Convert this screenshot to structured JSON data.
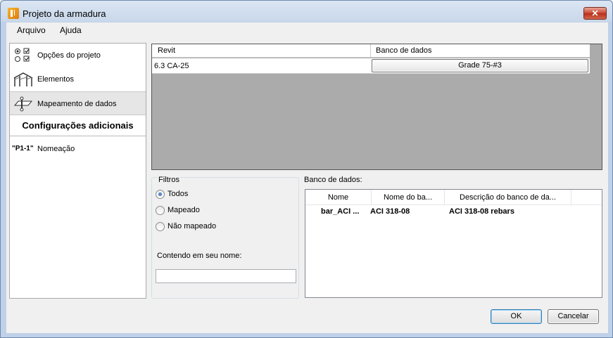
{
  "window": {
    "title": "Projeto da armadura"
  },
  "menu": [
    "Arquivo",
    "Ajuda"
  ],
  "sidebar": {
    "items": [
      {
        "label": "Opções do projeto",
        "icon": "options-icon"
      },
      {
        "label": "Elementos",
        "icon": "elements-icon"
      },
      {
        "label": "Mapeamento de dados",
        "icon": "data-mapping-icon"
      }
    ],
    "header": "Configurações adicionais",
    "naming": {
      "badge": "\"P1-1\"",
      "label": "Nomeação"
    }
  },
  "grid": {
    "columns": [
      "Revit",
      "Banco de dados"
    ],
    "rows": [
      {
        "revit": "6.3 CA-25",
        "database": "Grade 75-#3"
      }
    ]
  },
  "filters": {
    "legend": "Filtros",
    "options": [
      "Todos",
      "Mapeado",
      "Não mapeado"
    ],
    "selected": "Todos",
    "name_label": "Contendo em seu nome:",
    "name_value": ""
  },
  "database": {
    "label": "Banco de dados:",
    "columns": [
      "Nome",
      "Nome do ba...",
      "Descrição do banco de da..."
    ],
    "rows": [
      {
        "name": "bar_ACI ...",
        "db_name": "ACI 318-08",
        "description": "ACI 318-08 rebars"
      }
    ]
  },
  "buttons": {
    "ok": "OK",
    "cancel": "Cancelar"
  },
  "colors": {
    "accent": "#1d57a5",
    "grid_bg": "#ababab"
  }
}
